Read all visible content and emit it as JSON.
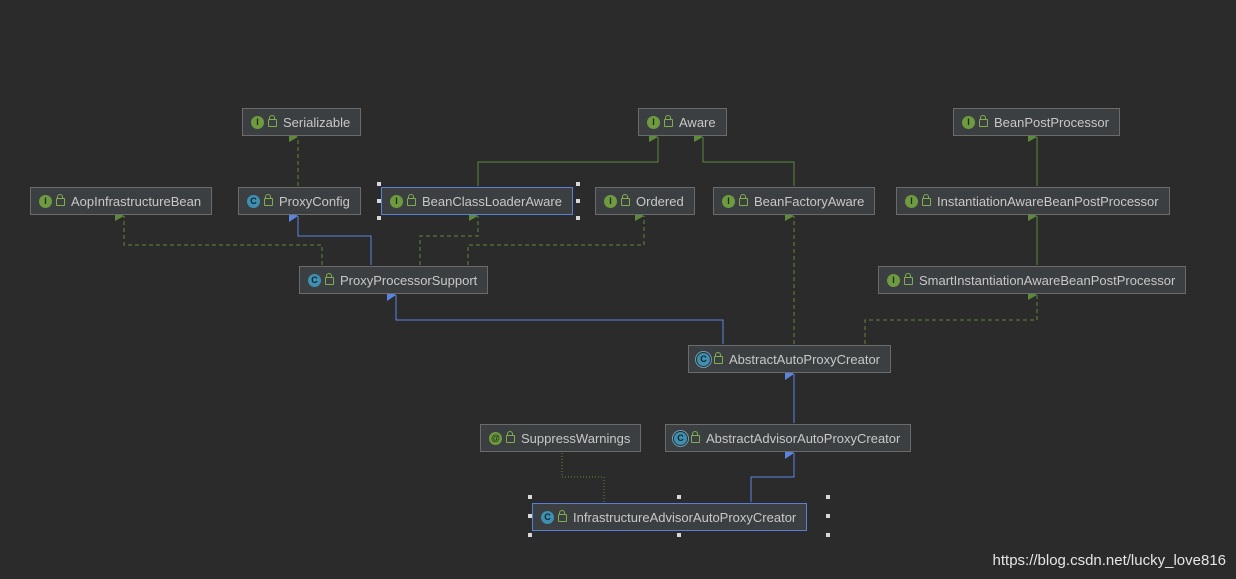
{
  "nodes": {
    "serializable": {
      "label": "Serializable",
      "kind": "I"
    },
    "aware": {
      "label": "Aware",
      "kind": "I"
    },
    "bean_post_processor": {
      "label": "BeanPostProcessor",
      "kind": "I"
    },
    "aop_infrastructure_bean": {
      "label": "AopInfrastructureBean",
      "kind": "I"
    },
    "proxy_config": {
      "label": "ProxyConfig",
      "kind": "C"
    },
    "bean_class_loader_aware": {
      "label": "BeanClassLoaderAware",
      "kind": "I"
    },
    "ordered": {
      "label": "Ordered",
      "kind": "I"
    },
    "bean_factory_aware": {
      "label": "BeanFactoryAware",
      "kind": "I"
    },
    "instantiation_aware_bpp": {
      "label": "InstantiationAwareBeanPostProcessor",
      "kind": "I"
    },
    "proxy_processor_support": {
      "label": "ProxyProcessorSupport",
      "kind": "C"
    },
    "smart_instantiation_aware_bpp": {
      "label": "SmartInstantiationAwareBeanPostProcessor",
      "kind": "I"
    },
    "abstract_auto_proxy_creator": {
      "label": "AbstractAutoProxyCreator",
      "kind": "C"
    },
    "suppress_warnings": {
      "label": "SuppressWarnings",
      "kind": "@"
    },
    "abstract_advisor_auto_proxy_creator": {
      "label": "AbstractAdvisorAutoProxyCreator",
      "kind": "C"
    },
    "infrastructure_advisor_auto_proxy_creator": {
      "label": "InfrastructureAdvisorAutoProxyCreator",
      "kind": "C"
    }
  },
  "colors": {
    "background": "#2b2b2b",
    "implements_edge": "#5c8a3a",
    "extends_edge": "#5b84e0",
    "annotation_edge": "#5c8a3a",
    "selection": "#5b7fd6"
  },
  "watermark": "https://blog.csdn.net/lucky_love816"
}
